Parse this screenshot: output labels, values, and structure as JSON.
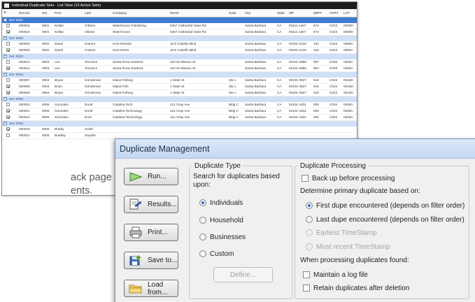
{
  "list_window": {
    "title": "Individual Duplicate Sets - List View (10 Active Sets)",
    "columns": [
      "",
      "Record",
      "Set",
      "First",
      "Last",
      "Company",
      "Street",
      "Suite",
      "City",
      "State",
      "ZIP",
      "delPT",
      "CRRT",
      "LOT"
    ],
    "rows": [
      {
        "type": "set",
        "label": "Set: 0001",
        "selected": true
      },
      {
        "type": "row",
        "checked": false,
        "cells": [
          "000015",
          "0001",
          "Kellan",
          "O'Brien",
          "Waterhouse Publishing",
          "5367 Cathedral Oaks Rd",
          "",
          "Santa Barbara",
          "CA",
          "93111-1467",
          "674",
          "C023",
          "0090D"
        ]
      },
      {
        "type": "row",
        "checked": true,
        "cells": [
          "000016",
          "0001",
          "Kellan",
          "Obrian",
          "Waterhouse",
          "5367 Cathedral Oaks Rd",
          "",
          "Santa Barbara",
          "CA",
          "93111-1467",
          "674",
          "C023",
          "0090D"
        ]
      },
      {
        "type": "set",
        "label": "Set: 0002",
        "selected": false
      },
      {
        "type": "row",
        "checked": false,
        "cells": [
          "000002",
          "0002",
          "David",
          "Kramer",
          "Host Rentals",
          "15 E Cabrillo Blvd",
          "",
          "Santa Barbara",
          "CA",
          "93101-2310",
          "154",
          "C022",
          "0096A"
        ]
      },
      {
        "type": "row",
        "checked": true,
        "cells": [
          "000003",
          "0002",
          "David",
          "Cramer",
          "Host Rents",
          "15 E Cabrillo Blvd",
          "",
          "Santa Barbara",
          "CA",
          "93101-2310",
          "154",
          "C022",
          "0096A"
        ]
      },
      {
        "type": "set",
        "label": "Set: 0003",
        "selected": false
      },
      {
        "type": "row",
        "checked": false,
        "cells": [
          "000013",
          "0003",
          "Lee",
          "Terrence",
          "Santa Rosa Gardens",
          "222 W Mission St",
          "",
          "Santa Barbara",
          "CA",
          "93101-2865",
          "997",
          "C020",
          "0306A"
        ]
      },
      {
        "type": "row",
        "checked": true,
        "cells": [
          "000014",
          "0003",
          "Lee",
          "Torrance",
          "Santa Rosa Gardens",
          "222 W Mission St",
          "",
          "Santa Barbara",
          "CA",
          "93101-2865",
          "997",
          "C020",
          "0306A"
        ]
      },
      {
        "type": "set",
        "label": "Set: 0004",
        "selected": false
      },
      {
        "type": "row",
        "checked": false,
        "cells": [
          "000007",
          "0004",
          "Bryan",
          "Grindeman",
          "Island Fishing",
          "1 State St",
          "Ste L",
          "Santa Barbara",
          "CA",
          "93101-3527",
          "018",
          "C022",
          "0044D"
        ]
      },
      {
        "type": "row",
        "checked": true,
        "cells": [
          "000008",
          "0004",
          "Brian",
          "Grindeman",
          "Island Fish",
          "1 State St",
          "Ste L",
          "Santa Barbara",
          "CA",
          "93101-3527",
          "018",
          "C022",
          "0044D"
        ]
      },
      {
        "type": "row",
        "checked": true,
        "cells": [
          "000009",
          "0004",
          "Bryan",
          "Grindeman",
          "Island Fishing",
          "1 State St",
          "Ste L",
          "Santa Barbara",
          "CA",
          "93101-3527",
          "018",
          "C022",
          "0044D"
        ]
      },
      {
        "type": "set",
        "label": "Set: 0005",
        "selected": false
      },
      {
        "type": "row",
        "checked": false,
        "cells": [
          "000010",
          "0005",
          "Gonzalvo",
          "Doraf",
          "Catalina Tech",
          "121 Gray Ave",
          "Bldg C",
          "Santa Barbara",
          "CA",
          "93101-1831",
          "005",
          "C004",
          "0208A"
        ]
      },
      {
        "type": "row",
        "checked": true,
        "cells": [
          "000011",
          "0005",
          "Gonzalez",
          "Doraf",
          "Catalina Technology",
          "121 Gray Ave",
          "Bldg C",
          "Santa Barbara",
          "CA",
          "93101-1831",
          "005",
          "C004",
          "0208A"
        ]
      },
      {
        "type": "row",
        "checked": true,
        "cells": [
          "000012",
          "0005",
          "Gonzalvo",
          "Dore",
          "Catalina Technology",
          "121 Gray Ave",
          "Bldg C",
          "Santa Barbara",
          "CA",
          "93101-1831",
          "005",
          "C004",
          "0208A"
        ]
      },
      {
        "type": "set",
        "label": "Set: 0006",
        "selected": false
      },
      {
        "type": "row",
        "checked": true,
        "cells": [
          "000019",
          "0006",
          "Bradly",
          "Smith",
          "",
          "",
          "",
          "",
          "",
          "",
          "",
          "",
          ""
        ]
      },
      {
        "type": "row",
        "checked": false,
        "cells": [
          "000021",
          "0006",
          "Bradley",
          "Smythe",
          "",
          "",
          "",
          "",
          "",
          "",
          "",
          "",
          ""
        ]
      }
    ]
  },
  "left_text": {
    "line1": "ack page",
    "line2": "ents."
  },
  "dialog": {
    "title": "Duplicate Management",
    "buttons": {
      "run": "Run...",
      "results": "Results...",
      "print": "Print...",
      "save": "Save to...",
      "load": "Load from..."
    },
    "duplicate_type": {
      "legend": "Duplicate Type",
      "prompt": "Search for duplicates based upon:",
      "options": {
        "individuals": "Individuals",
        "household": "Household",
        "businesses": "Businesses",
        "custom": "Custom"
      },
      "selected": "Individuals",
      "define_button": "Define..."
    },
    "processing": {
      "legend": "Duplicate Processing",
      "backup_label": "Back up before processing",
      "determine_label": "Determine primary duplicate based on:",
      "options": {
        "first": "First dupe encountered  (depends on filter order)",
        "last": "Last dupe encountered  (depends on filter order)",
        "earliest": "Earliest TimeStamp",
        "recent": "Most recent TimeStamp"
      },
      "selected": "First dupe encountered  (depends on filter order)",
      "when_found_label": "When processing duplicates found:",
      "log_label": "Maintain a log file",
      "retain_label": "Retain duplicates after deletion"
    }
  }
}
